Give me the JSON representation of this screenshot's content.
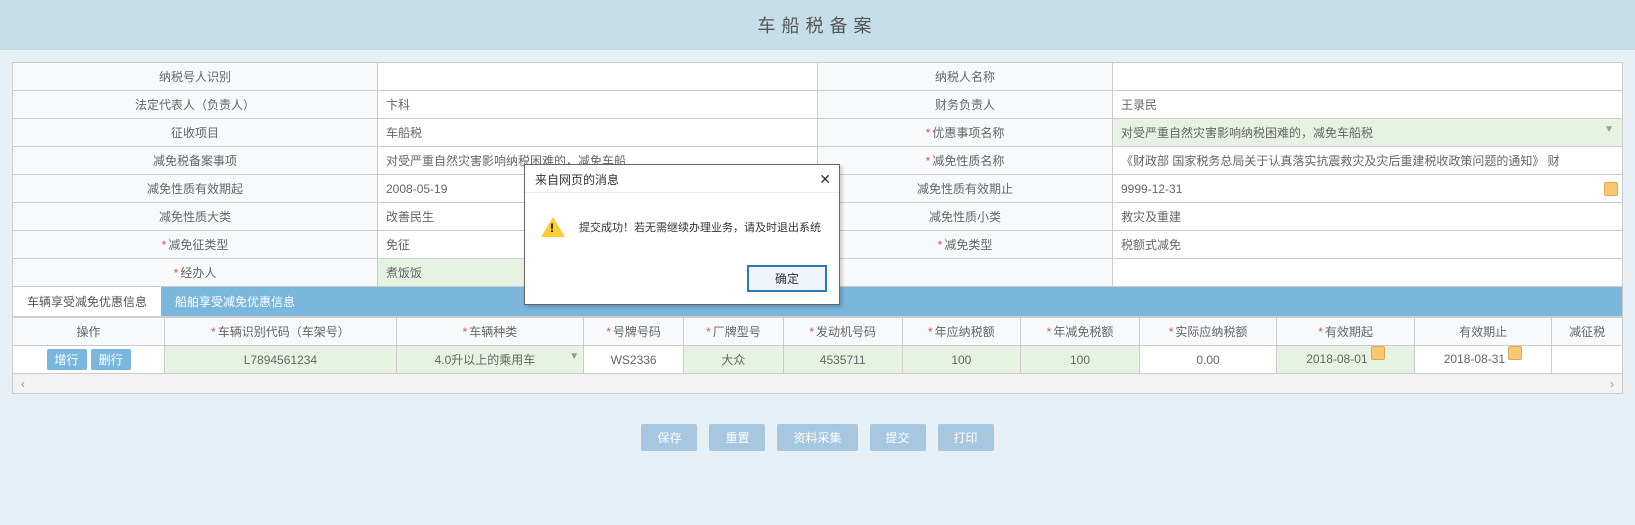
{
  "page_title": "车船税备案",
  "form": {
    "rows": [
      {
        "l1": "纳税号人识别",
        "v1": "",
        "l2": "纳税人名称",
        "v2": ""
      },
      {
        "l1": "法定代表人（负责人）",
        "v1": "卞科",
        "l2": "财务负责人",
        "v2": "王录民"
      },
      {
        "l1": "征收项目",
        "v1": "车船税",
        "l2": "优惠事项名称",
        "l2_req": true,
        "v2": "对受严重自然灾害影响纳税困难的，减免车船税",
        "v2_green": true,
        "v2_drop": true
      },
      {
        "l1": "减免税备案事项",
        "v1": "对受严重自然灾害影响纳税困难的，减免车船",
        "l2": "减免性质名称",
        "l2_req": true,
        "v2": "《财政部 国家税务总局关于认真落实抗震救灾及灾后重建税收政策问题的通知》 财"
      },
      {
        "l1": "减免性质有效期起",
        "v1": "2008-05-19",
        "l2": "减免性质有效期止",
        "v2": "9999-12-31",
        "v2_date": true
      },
      {
        "l1": "减免性质大类",
        "v1": "改善民生",
        "l2": "减免性质小类",
        "v2": "救灾及重建"
      },
      {
        "l1": "减免征类型",
        "l1_req": true,
        "v1": "免征",
        "l2": "减免类型",
        "l2_req": true,
        "v2": "税额式减免"
      },
      {
        "l1": "经办人",
        "l1_req": true,
        "v1": "煮饭饭",
        "v1_green": true,
        "l2": "",
        "v2": ""
      }
    ]
  },
  "tabs": [
    {
      "label": "车辆享受减免优惠信息",
      "active": true
    },
    {
      "label": "船舶享受减免优惠信息",
      "active": false
    }
  ],
  "grid": {
    "headers": [
      "操作",
      "车辆识别代码（车架号）",
      "车辆种类",
      "号牌号码",
      "厂牌型号",
      "发动机号码",
      "年应纳税额",
      "年减免税额",
      "实际应纳税额",
      "有效期起",
      "有效期止",
      "减征税"
    ],
    "req": [
      false,
      true,
      true,
      true,
      true,
      true,
      true,
      true,
      true,
      true,
      false,
      false
    ],
    "actions": {
      "add": "增行",
      "del": "删行"
    },
    "row": {
      "vin": "L7894561234",
      "vehicle_type": "4.0升以上的乘用车",
      "plate": "WS2336",
      "brand": "大众",
      "engine": "4535711",
      "tax_due": "100",
      "tax_reduce": "100",
      "tax_actual": "0.00",
      "valid_from": "2018-08-01",
      "valid_to": "2018-08-31"
    }
  },
  "footer_buttons": [
    "保存",
    "重置",
    "资料采集",
    "提交",
    "打印"
  ],
  "dialog": {
    "title": "来自网页的消息",
    "message": "提交成功！若无需继续办理业务，请及时退出系统",
    "ok": "确定"
  }
}
